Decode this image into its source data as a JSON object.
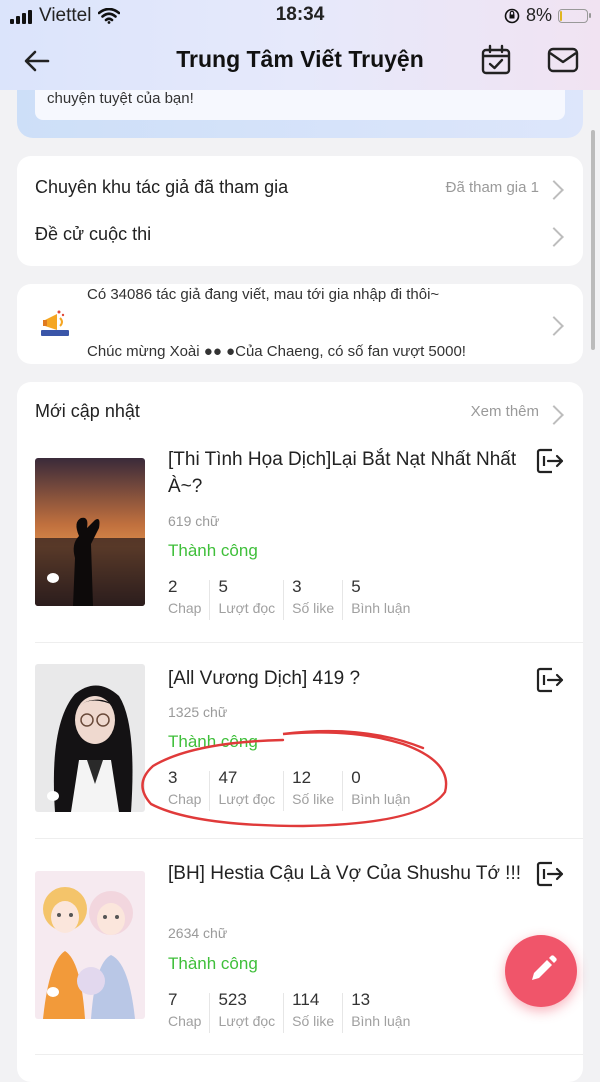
{
  "status_bar": {
    "carrier": "Viettel",
    "time": "18:34",
    "battery": "8%"
  },
  "nav": {
    "title": "Trung Tâm Viết Truyện"
  },
  "banner": {
    "text": "chuyện tuyệt của bạn!"
  },
  "menu": {
    "items": [
      {
        "label": "Chuyên khu tác giả đã tham gia",
        "right": "Đã tham gia 1"
      },
      {
        "label": "Đề cử cuộc thi",
        "right": ""
      }
    ]
  },
  "notice": {
    "line1": "Có 34086 tác giả đang viết, mau tới gia nhập đi thôi~",
    "line2": "Chúc mừng Xoài ●● ●Của Chaeng, có số fan vượt 5000!"
  },
  "updates": {
    "header": "Mới cập nhật",
    "see_more": "Xem thêm",
    "stories": [
      {
        "title": "[Thi Tình Họa Dịch]Lại Bắt Nạt Nhất Nhất À~?",
        "words": "619 chữ",
        "status": "Thành công",
        "chap": "2",
        "reads": "5",
        "likes": "3",
        "comments": "5"
      },
      {
        "title": "[All Vương Dịch] 419 ?",
        "words": "1325 chữ",
        "status": "Thành công",
        "chap": "3",
        "reads": "47",
        "likes": "12",
        "comments": "0"
      },
      {
        "title": "[BH] Hestia Cậu Là Vợ Của Shushu Tớ !!!",
        "words": "2634 chữ",
        "status": "Thành công",
        "chap": "7",
        "reads": "523",
        "likes": "114",
        "comments": "13"
      }
    ],
    "stat_labels": {
      "chap": "Chap",
      "reads": "Lượt đọc",
      "likes": "Số like",
      "comments": "Bình luận"
    }
  },
  "colors": {
    "accent": "#f0556a",
    "success": "#3fbf3a",
    "muted": "#9a9a9a",
    "nav_gradient": "#dbe4fb"
  }
}
